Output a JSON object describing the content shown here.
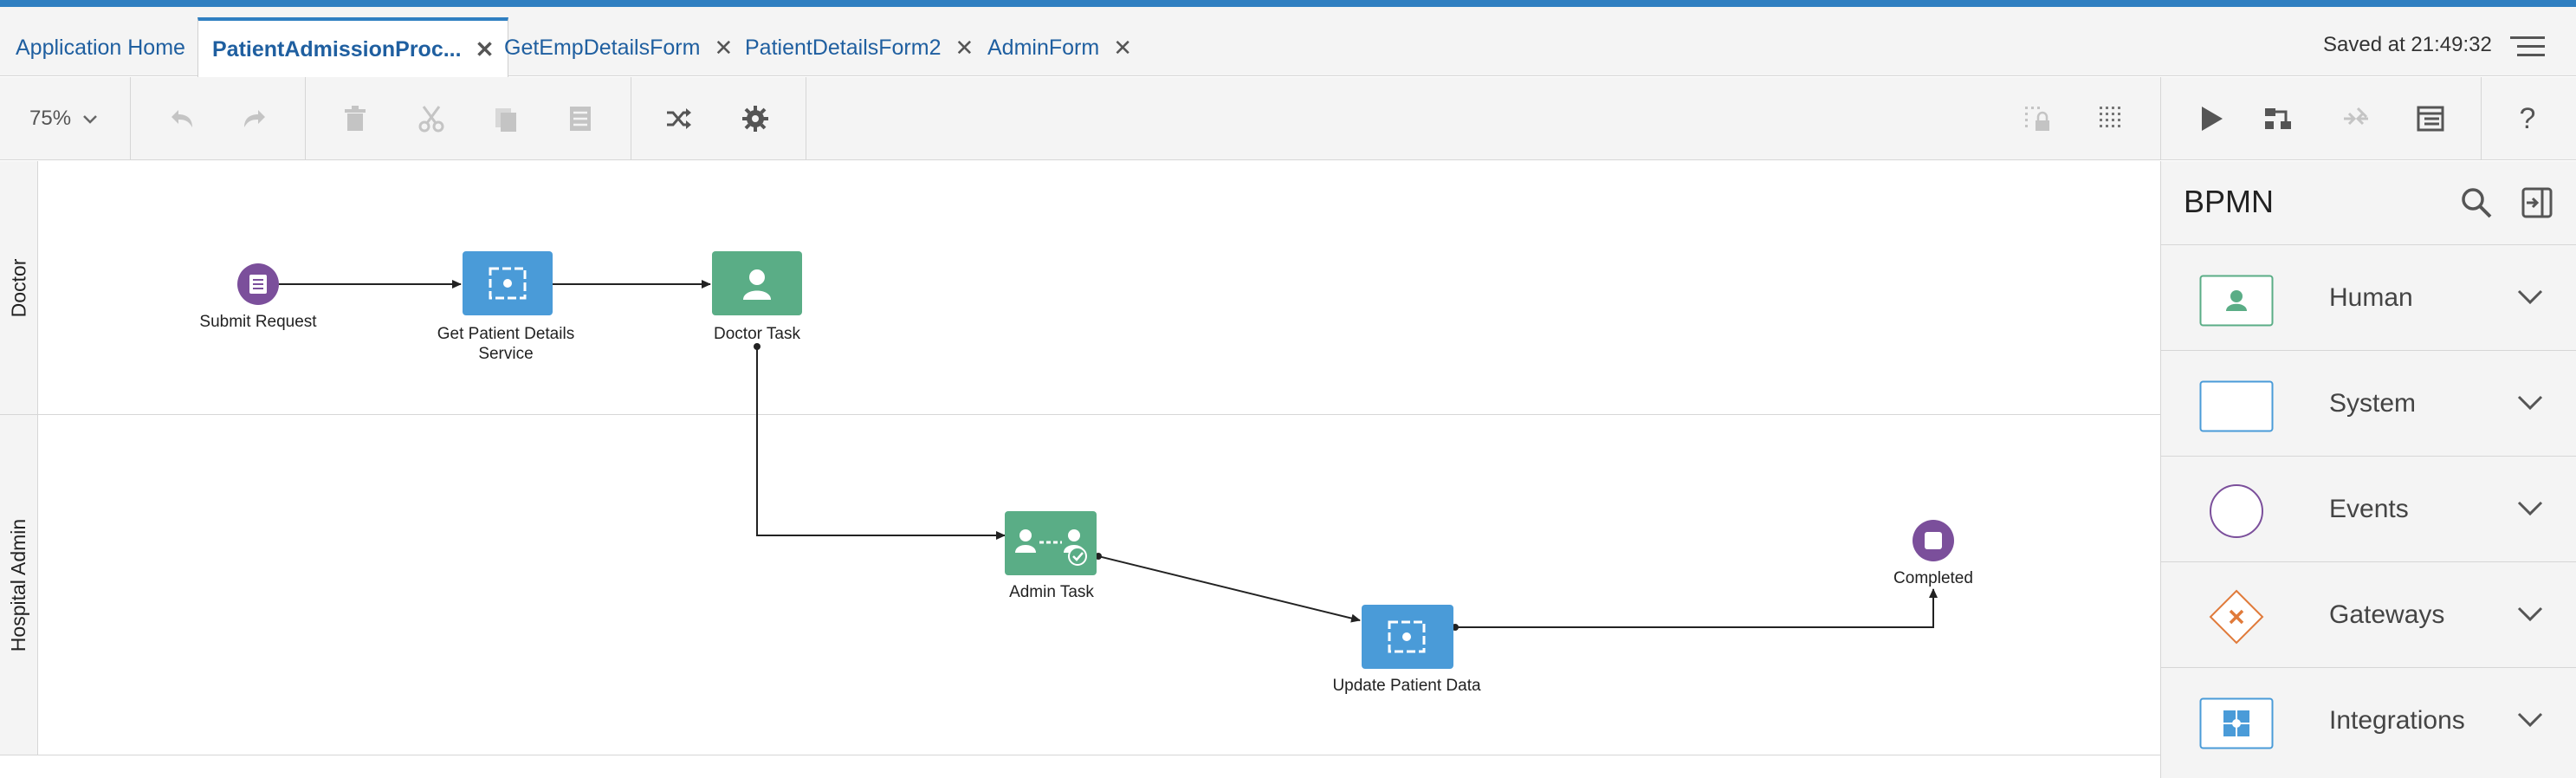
{
  "tabs": [
    {
      "label": "Application Home",
      "closable": false,
      "active": false
    },
    {
      "label": "PatientAdmissionProc...",
      "closable": true,
      "active": true
    },
    {
      "label": "GetEmpDetailsForm",
      "closable": true,
      "active": false
    },
    {
      "label": "PatientDetailsForm2",
      "closable": true,
      "active": false
    },
    {
      "label": "AdminForm",
      "closable": true,
      "active": false
    }
  ],
  "tab_close_glyph": "✕",
  "status": {
    "saved_text": "Saved at 21:49:32"
  },
  "toolbar": {
    "zoom": "75%",
    "icons": [
      "undo-icon",
      "redo-icon",
      "delete-icon",
      "cut-icon",
      "copy-icon",
      "properties-icon",
      "shuffle-icon",
      "gear-icon",
      "lock-grid-icon",
      "grid-icon",
      "play-icon",
      "flow-icon",
      "collapse-icon",
      "form-icon",
      "help-icon"
    ],
    "help_label": "?"
  },
  "lanes": [
    {
      "name": "Doctor"
    },
    {
      "name": "Hospital Admin"
    }
  ],
  "nodes": {
    "submit_request": "Submit Request",
    "get_patient_details_1": "Get Patient Details",
    "get_patient_details_2": "Service",
    "doctor_task": "Doctor Task",
    "admin_task": "Admin Task",
    "update_patient_data": "Update Patient Data",
    "completed": "Completed"
  },
  "palette": {
    "title": "BPMN",
    "items": [
      {
        "label": "Human",
        "icon": "human-task-icon"
      },
      {
        "label": "System",
        "icon": "system-task-icon"
      },
      {
        "label": "Events",
        "icon": "event-circle-icon"
      },
      {
        "label": "Gateways",
        "icon": "gateway-diamond-icon"
      },
      {
        "label": "Integrations",
        "icon": "integration-puzzle-icon"
      }
    ]
  },
  "colors": {
    "accent": "#2f7fc1",
    "human_task": "#5aad86",
    "service_task": "#4a9bd8",
    "event": "#7b4f9b",
    "gateway": "#e07a3a"
  }
}
